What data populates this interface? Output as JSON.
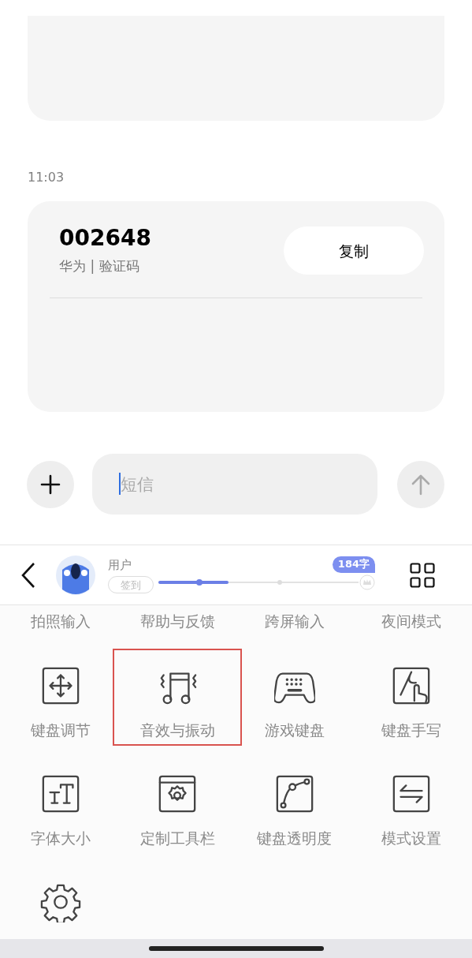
{
  "messages": {
    "time": "11:03",
    "code": "002648",
    "sender": "华为 | 验证码",
    "copy_button": "复制"
  },
  "compose": {
    "placeholder": "短信"
  },
  "keyboard_toolbar": {
    "user": "用户",
    "checkin": "签到",
    "badge": "184字",
    "level": 0.35
  },
  "tools": [
    {
      "label": "拍照输入",
      "kind": "none",
      "highlighted": false
    },
    {
      "label": "帮助与反馈",
      "kind": "none",
      "highlighted": false
    },
    {
      "label": "跨屏输入",
      "kind": "none",
      "highlighted": false
    },
    {
      "label": "夜间模式",
      "kind": "none",
      "highlighted": false
    },
    {
      "label": "键盘调节",
      "kind": "move",
      "highlighted": false
    },
    {
      "label": "音效与振动",
      "kind": "music",
      "highlighted": true
    },
    {
      "label": "游戏键盘",
      "kind": "gamepad",
      "highlighted": false
    },
    {
      "label": "键盘手写",
      "kind": "handwrite",
      "highlighted": false
    },
    {
      "label": "字体大小",
      "kind": "font",
      "highlighted": false
    },
    {
      "label": "定制工具栏",
      "kind": "toolbar",
      "highlighted": false
    },
    {
      "label": "键盘透明度",
      "kind": "curve",
      "highlighted": false
    },
    {
      "label": "模式设置",
      "kind": "swap",
      "highlighted": false
    },
    {
      "kind": "gear",
      "highlighted": false
    }
  ]
}
